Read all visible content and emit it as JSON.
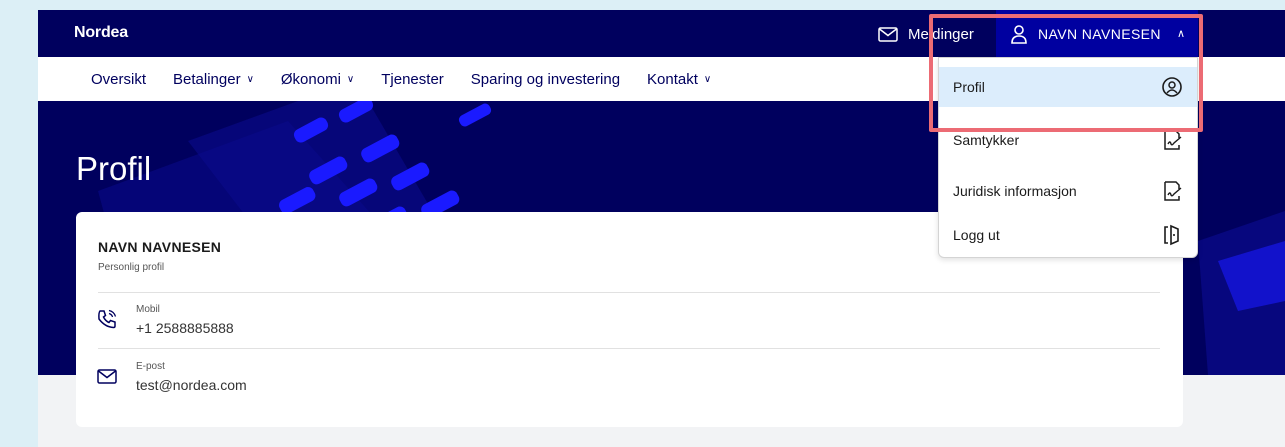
{
  "header": {
    "logo": "Nordea",
    "messages_label": "Meldinger",
    "user_name": "NAVN NAVNESEN"
  },
  "nav": {
    "items": [
      {
        "label": "Oversikt",
        "has_caret": false
      },
      {
        "label": "Betalinger",
        "has_caret": true
      },
      {
        "label": "Økonomi",
        "has_caret": true
      },
      {
        "label": "Tjenester",
        "has_caret": false
      },
      {
        "label": "Sparing og investering",
        "has_caret": false
      },
      {
        "label": "Kontakt",
        "has_caret": true
      }
    ]
  },
  "page": {
    "title": "Profil"
  },
  "profile_card": {
    "name": "NAVN NAVNESEN",
    "subtitle": "Personlig profil",
    "phone_label": "Mobil",
    "phone_value": "+1 2588885888",
    "email_label": "E-post",
    "email_value": "test@nordea.com"
  },
  "user_menu": {
    "items": [
      {
        "label": "Profil",
        "icon": "user-circle-icon",
        "active": true
      },
      {
        "label": "Samtykker",
        "icon": "document-signature-icon",
        "active": false
      },
      {
        "label": "Juridisk informasjon",
        "icon": "document-signature-icon",
        "active": false
      },
      {
        "label": "Logg ut",
        "icon": "logout-icon",
        "active": false
      }
    ]
  },
  "colors": {
    "brand_dark": "#00005e",
    "brand_blue": "#0000a0",
    "highlight": "#ec6b74",
    "active_item": "#dcedfc"
  }
}
